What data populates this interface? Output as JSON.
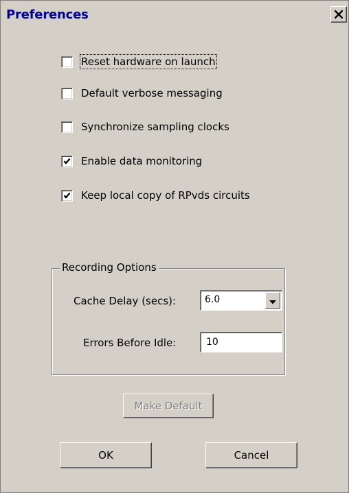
{
  "window": {
    "title": "Preferences",
    "close_icon": "close-x-icon"
  },
  "checkboxes": [
    {
      "label": "Reset hardware on launch",
      "checked": false,
      "focused": true
    },
    {
      "label": "Default verbose messaging",
      "checked": false,
      "focused": false
    },
    {
      "label": "Synchronize sampling clocks",
      "checked": false,
      "focused": false
    },
    {
      "label": "Enable data monitoring",
      "checked": true,
      "focused": false
    },
    {
      "label": "Keep local copy of RPvds circuits",
      "checked": true,
      "focused": false
    }
  ],
  "recording": {
    "group_label": "Recording Options",
    "cache_delay_label": "Cache Delay (secs):",
    "cache_delay_value": "6.0",
    "errors_label": "Errors Before Idle:",
    "errors_value": "10"
  },
  "buttons": {
    "make_default": "Make Default",
    "ok": "OK",
    "cancel": "Cancel"
  },
  "colors": {
    "window_bg": "#d4d0c8",
    "title_text": "#0000a0",
    "disabled_text": "#808080"
  }
}
